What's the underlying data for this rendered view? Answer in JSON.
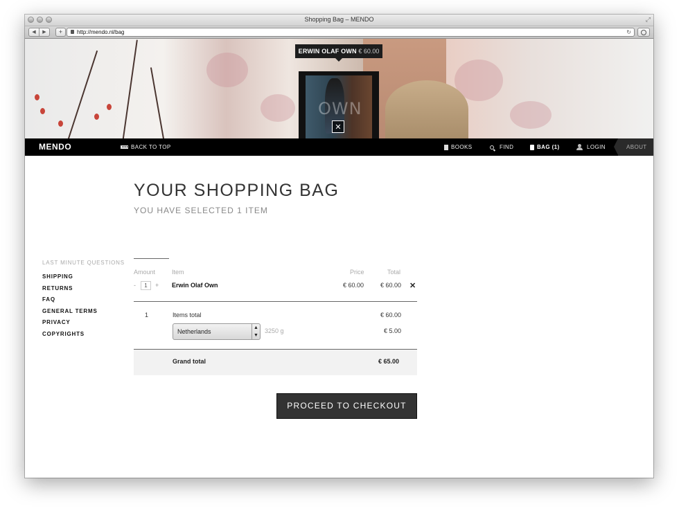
{
  "window": {
    "title": "Shopping Bag – MENDO"
  },
  "browser": {
    "url": "http://mendo.nl/bag"
  },
  "hero": {
    "tooltip_name": "ERWIN OLAF OWN",
    "tooltip_price": "€ 60.00",
    "book_cover_text": "OWN",
    "close_glyph": "✕"
  },
  "nav": {
    "logo": "MENDO",
    "back_to_top": "BACK TO TOP",
    "books": "BOOKS",
    "find": "FIND",
    "bag": "BAG (1)",
    "login": "LOGIN",
    "about": "ABOUT"
  },
  "page": {
    "heading": "YOUR SHOPPING BAG",
    "subheading": "YOU HAVE SELECTED 1 ITEM"
  },
  "sidebar": {
    "title": "LAST MINUTE QUESTIONS",
    "links": [
      "SHIPPING",
      "RETURNS",
      "FAQ",
      "GENERAL TERMS",
      "PRIVACY",
      "COPYRIGHTS"
    ]
  },
  "cart": {
    "headers": {
      "amount": "Amount",
      "item": "Item",
      "price": "Price",
      "total": "Total"
    },
    "item": {
      "minus": "-",
      "qty": "1",
      "plus": "+",
      "name": "Erwin Olaf Own",
      "price": "€ 60.00",
      "total": "€ 60.00",
      "remove": "✕"
    },
    "items_count": "1",
    "items_total_label": "Items total",
    "items_total": "€ 60.00",
    "country": "Netherlands",
    "weight": "3250 g",
    "shipping": "€ 5.00",
    "grand_total_label": "Grand total",
    "grand_total": "€ 65.00",
    "checkout_label": "PROCEED TO CHECKOUT"
  }
}
